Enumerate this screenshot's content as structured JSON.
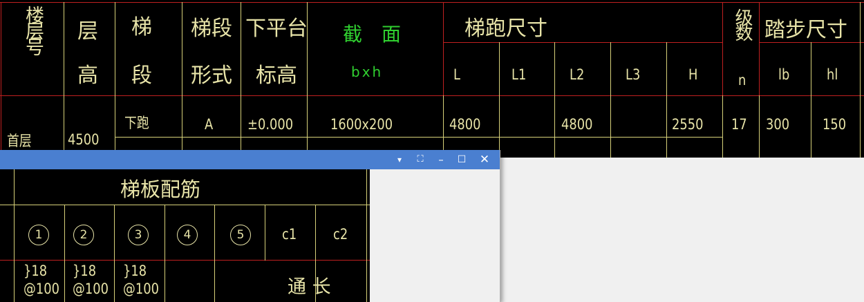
{
  "main_table": {
    "headers": {
      "floor_no": "楼层号",
      "story_height": [
        "层",
        "高"
      ],
      "flight": [
        "梯",
        "段"
      ],
      "flight_type": [
        "梯段",
        "形式"
      ],
      "landing_elev": [
        "下平台",
        "标高"
      ],
      "section": "截　面",
      "section_sub": "bxh",
      "run_size": "梯跑尺寸",
      "run_cols": [
        "L",
        "L1",
        "L2",
        "L3",
        "H"
      ],
      "steps": "级数",
      "steps_sub": "n",
      "tread_size": "踏步尺寸",
      "tread_cols": [
        "lb",
        "hl"
      ]
    },
    "row1": {
      "floor": "首层",
      "height": "4500",
      "flight": "下跑",
      "type": "A",
      "elev": "±0.000",
      "section": "1600x200",
      "L": "4800",
      "L1": "",
      "L2": "4800",
      "L3": "",
      "H": "2550",
      "n": "17",
      "lb": "300",
      "hl": "150"
    }
  },
  "float_window": {
    "title_controls": [
      "▾",
      "⛶",
      "–",
      "☐",
      "✕"
    ],
    "sub_table": {
      "title": "梯板配筋",
      "circle_cols": [
        "1",
        "2",
        "3",
        "4",
        "5"
      ],
      "text_cols": [
        "c1",
        "c2"
      ],
      "rebar": [
        "}18\n@100",
        "}18\n@100",
        "}18\n@100"
      ],
      "through_label": "通 长"
    }
  }
}
